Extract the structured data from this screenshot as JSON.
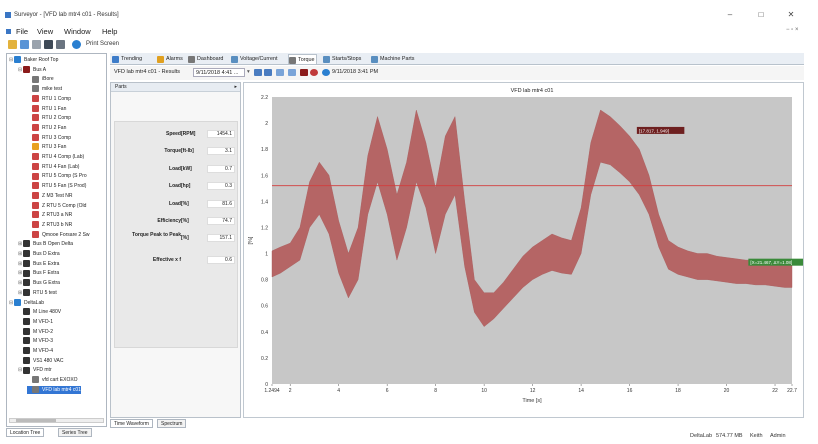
{
  "window": {
    "title": "Surveyor - [VFD lab mtr4 c01 - Results]",
    "min": "–",
    "max": "□",
    "close": "✕"
  },
  "menu": [
    "File",
    "View",
    "Window",
    "Help"
  ],
  "toolbar": {
    "print_label": "Print Screen"
  },
  "tree": [
    {
      "label": "Baker Roof Top",
      "level": 0,
      "exp": "⊟",
      "icon": "site",
      "color": "#2a7fd0"
    },
    {
      "label": "Bus A",
      "level": 1,
      "exp": "⊟",
      "icon": "bus",
      "color": "#8b1b1b"
    },
    {
      "label": "iBore",
      "level": 2,
      "exp": "",
      "icon": "motor",
      "color": "#777"
    },
    {
      "label": "mike test",
      "level": 2,
      "exp": "",
      "icon": "motor",
      "color": "#777"
    },
    {
      "label": "RTU 1 Comp",
      "level": 2,
      "exp": "",
      "icon": "alarm",
      "color": "#c44"
    },
    {
      "label": "RTU 1 Fan",
      "level": 2,
      "exp": "",
      "icon": "alarm",
      "color": "#c44"
    },
    {
      "label": "RTU 2 Comp",
      "level": 2,
      "exp": "",
      "icon": "alarm",
      "color": "#c44"
    },
    {
      "label": "RTU 2 Fan",
      "level": 2,
      "exp": "",
      "icon": "alarm",
      "color": "#c44"
    },
    {
      "label": "RTU 3 Comp",
      "level": 2,
      "exp": "",
      "icon": "alarm",
      "color": "#c44"
    },
    {
      "label": "RTU 3 Fan",
      "level": 2,
      "exp": "",
      "icon": "warn",
      "color": "#e8a020"
    },
    {
      "label": "RTU 4 Comp (Lab)",
      "level": 2,
      "exp": "",
      "icon": "alarm",
      "color": "#c44"
    },
    {
      "label": "RTU 4 Fan (Lab)",
      "level": 2,
      "exp": "",
      "icon": "alarm",
      "color": "#c44"
    },
    {
      "label": "RTU 5 Comp (S Pro",
      "level": 2,
      "exp": "",
      "icon": "alarm",
      "color": "#c44"
    },
    {
      "label": "RTU 5 Fan (S Prod)",
      "level": 2,
      "exp": "",
      "icon": "alarm",
      "color": "#c44"
    },
    {
      "label": "Z M3 Test NR",
      "level": 2,
      "exp": "",
      "icon": "alarm",
      "color": "#c44"
    },
    {
      "label": "Z RTU 5 Comp (Old",
      "level": 2,
      "exp": "",
      "icon": "alarm",
      "color": "#c44"
    },
    {
      "label": "Z RTU3 a NR",
      "level": 2,
      "exp": "",
      "icon": "alarm",
      "color": "#c44"
    },
    {
      "label": "Z RTU3 b NR",
      "level": 2,
      "exp": "",
      "icon": "alarm",
      "color": "#c44"
    },
    {
      "label": "Qmooe Forsare 2 Sw",
      "level": 2,
      "exp": "",
      "icon": "alarm",
      "color": "#c44"
    },
    {
      "label": "Bus B Open Delta",
      "level": 1,
      "exp": "⊞",
      "icon": "bus",
      "color": "#333"
    },
    {
      "label": "Bus D Extra",
      "level": 1,
      "exp": "⊞",
      "icon": "bus",
      "color": "#333"
    },
    {
      "label": "Bus E Extra",
      "level": 1,
      "exp": "⊞",
      "icon": "bus",
      "color": "#333"
    },
    {
      "label": "Bus F Extra",
      "level": 1,
      "exp": "⊞",
      "icon": "bus",
      "color": "#333"
    },
    {
      "label": "Bus G Extra",
      "level": 1,
      "exp": "⊞",
      "icon": "bus",
      "color": "#333"
    },
    {
      "label": "RTU 5 test",
      "level": 1,
      "exp": "⊞",
      "icon": "bus",
      "color": "#333"
    },
    {
      "label": "DeltaLab",
      "level": 0,
      "exp": "⊟",
      "icon": "site",
      "color": "#2a7fd0"
    },
    {
      "label": "M Line 480V",
      "level": 1,
      "exp": "",
      "icon": "bus",
      "color": "#333"
    },
    {
      "label": "M VFD-1",
      "level": 1,
      "exp": "",
      "icon": "bus",
      "color": "#333"
    },
    {
      "label": "M VFD-2",
      "level": 1,
      "exp": "",
      "icon": "bus",
      "color": "#333"
    },
    {
      "label": "M VFD-3",
      "level": 1,
      "exp": "",
      "icon": "bus",
      "color": "#333"
    },
    {
      "label": "M VFD-4",
      "level": 1,
      "exp": "",
      "icon": "bus",
      "color": "#333"
    },
    {
      "label": "VS1 480 VAC",
      "level": 1,
      "exp": "",
      "icon": "bus",
      "color": "#333"
    },
    {
      "label": "VFD mtr",
      "level": 1,
      "exp": "⊟",
      "icon": "bus",
      "color": "#333"
    },
    {
      "label": "vfd cart EXOXO",
      "level": 2,
      "exp": "",
      "icon": "motor",
      "color": "#777"
    },
    {
      "label": "VFD lab mtr4 c01",
      "level": 2,
      "exp": "",
      "icon": "motor",
      "color": "#777",
      "selected": true
    }
  ],
  "left_tabs": {
    "location": "Location Tree",
    "series": "Series Tree"
  },
  "tabs": [
    {
      "label": "Trending",
      "color": "#3d7cc9"
    },
    {
      "label": "Alarms",
      "color": "#e0a020"
    },
    {
      "label": "Dashboard",
      "color": "#777"
    },
    {
      "label": "Voltage/Current",
      "color": "#5a8fc0"
    },
    {
      "label": "Torque",
      "color": "#777",
      "active": true
    },
    {
      "label": "Starts/Stops",
      "color": "#5a8fc0"
    },
    {
      "label": "Machine Parts",
      "color": "#5a8fc0"
    }
  ],
  "subtoolbar": {
    "source": "VFD lab mtr4 c01 - Results",
    "date": "9/11/2018 4:41 ...",
    "timestamp": "9/11/2018 3:41 PM"
  },
  "props": {
    "header": "Parts",
    "rows": [
      {
        "name": "Speed",
        "unit": "[RPM]",
        "value": "1454.1"
      },
      {
        "name": "Torque",
        "unit": "[ft-lb]",
        "value": "3.1"
      },
      {
        "name": "Load",
        "unit": "[kW]",
        "value": "0.7"
      },
      {
        "name": "Load",
        "unit": "[hp]",
        "value": "0.3"
      },
      {
        "name": "Load",
        "unit": "[%]",
        "value": "81.6"
      },
      {
        "name": "Efficiency",
        "unit": "[%]",
        "value": "74.7"
      },
      {
        "name": "Torque Peak to Peak",
        "unit": "[%]",
        "value": "157.1"
      },
      {
        "name": "Effective x f",
        "unit": "",
        "value": "0.6"
      }
    ]
  },
  "mid_tabs": {
    "waveform": "Time Waveform",
    "spectrum": "Spectrum"
  },
  "chart_data": {
    "type": "line",
    "title": "VFD lab mtr4 c01",
    "xlabel": "Time [s]",
    "ylabel": "[%]",
    "xlim": [
      1.2494,
      22.7
    ],
    "ylim": [
      0,
      2.2
    ],
    "x_ticks": [
      "1.2494",
      "2",
      "4",
      "6",
      "8",
      "10",
      "12",
      "14",
      "16",
      "18",
      "20",
      "22",
      "22.7"
    ],
    "y_ticks": [
      "0",
      "0.2",
      "0.4",
      "0.6",
      "0.8",
      "1",
      "1.2",
      "1.4",
      "1.6",
      "1.8",
      "2",
      "2.2"
    ],
    "reference_line": 1.52,
    "series_color": "#b56565",
    "reference_color": "#d43c3c",
    "envelope": {
      "x": [
        1.25,
        1.6,
        2.0,
        2.4,
        2.8,
        3.2,
        3.6,
        4.0,
        4.4,
        4.8,
        5.2,
        5.6,
        6.0,
        6.4,
        6.8,
        7.2,
        7.6,
        8.0,
        8.4,
        8.8,
        9.2,
        9.6,
        10.0,
        10.4,
        10.8,
        11.2,
        11.6,
        12.0,
        12.4,
        12.8,
        13.2,
        13.6,
        14.0,
        14.4,
        14.8,
        15.2,
        15.6,
        16.0,
        16.4,
        16.8,
        17.2,
        17.6,
        18.0,
        18.4,
        18.8,
        19.2,
        19.6,
        20.0,
        20.4,
        20.8,
        21.2,
        21.6,
        22.0,
        22.4,
        22.7
      ],
      "upper": [
        1.02,
        1.05,
        1.08,
        1.2,
        1.55,
        1.7,
        1.6,
        1.25,
        1.0,
        1.2,
        1.75,
        2.05,
        1.8,
        1.45,
        1.7,
        2.1,
        1.85,
        1.5,
        1.9,
        2.05,
        1.4,
        0.8,
        0.7,
        0.7,
        0.78,
        0.88,
        0.98,
        1.05,
        1.1,
        1.15,
        1.12,
        1.1,
        1.35,
        1.85,
        2.1,
        2.05,
        1.98,
        1.9,
        1.8,
        1.6,
        1.3,
        1.1,
        1.05,
        1.02,
        1.0,
        1.0,
        0.98,
        0.97,
        0.96,
        0.95,
        0.95,
        0.94,
        0.93,
        0.92,
        0.92
      ],
      "lower": [
        0.82,
        0.85,
        0.9,
        0.95,
        1.2,
        1.3,
        1.15,
        0.85,
        0.66,
        0.8,
        1.3,
        1.55,
        1.3,
        0.95,
        1.2,
        1.55,
        1.35,
        1.0,
        1.3,
        1.45,
        0.9,
        0.55,
        0.44,
        0.5,
        0.58,
        0.66,
        0.74,
        0.8,
        0.84,
        0.87,
        0.85,
        0.84,
        1.0,
        1.45,
        1.7,
        1.68,
        1.62,
        1.55,
        1.45,
        1.3,
        1.05,
        0.88,
        0.84,
        0.82,
        0.8,
        0.8,
        0.79,
        0.78,
        0.77,
        0.77,
        0.76,
        0.76,
        0.75,
        0.74,
        0.74
      ]
    },
    "annotations": [
      {
        "x": 16.3,
        "y": 1.94,
        "text": "[17.817, 1.949]"
      },
      {
        "x": 20.9,
        "y": 0.93,
        "text": "[X=21.467, ΔY=1.08]"
      }
    ]
  },
  "status": {
    "left": "DeltaLab",
    "mid": "574.77 MB",
    "user": "Keith",
    "role": "Admin"
  }
}
